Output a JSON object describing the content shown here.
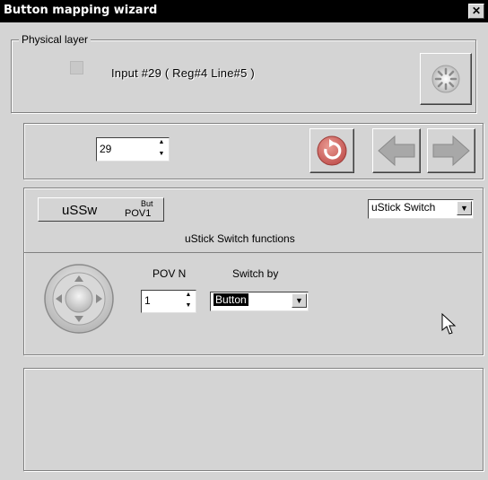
{
  "window": {
    "title": "Button mapping wizard",
    "close_glyph": "✕"
  },
  "physical_layer": {
    "legend": "Physical layer",
    "checkbox_checked": false,
    "input_text": "Input #29  ( Reg#4  Line#5 )",
    "action_icon": "gear-icon"
  },
  "navigation": {
    "spinner_value": "29",
    "icons": [
      "refresh-icon",
      "arrow-left-icon",
      "arrow-right-icon"
    ]
  },
  "mapping": {
    "button_main": "uSSw",
    "button_sup": "But",
    "button_sub": "POV1",
    "function_select": "uStick Switch",
    "functions_title": "uStick Switch functions",
    "joystick_icon": "dpad-icon",
    "pov_label": "POV N",
    "pov_value": "1",
    "switch_by_label": "Switch by",
    "switch_by_value": "Button"
  },
  "colors": {
    "titlebar_bg": "#000000",
    "window_bg": "#d4d4d4",
    "arrow_red": "#c0504d",
    "arrow_gray": "#a8a8a8"
  }
}
